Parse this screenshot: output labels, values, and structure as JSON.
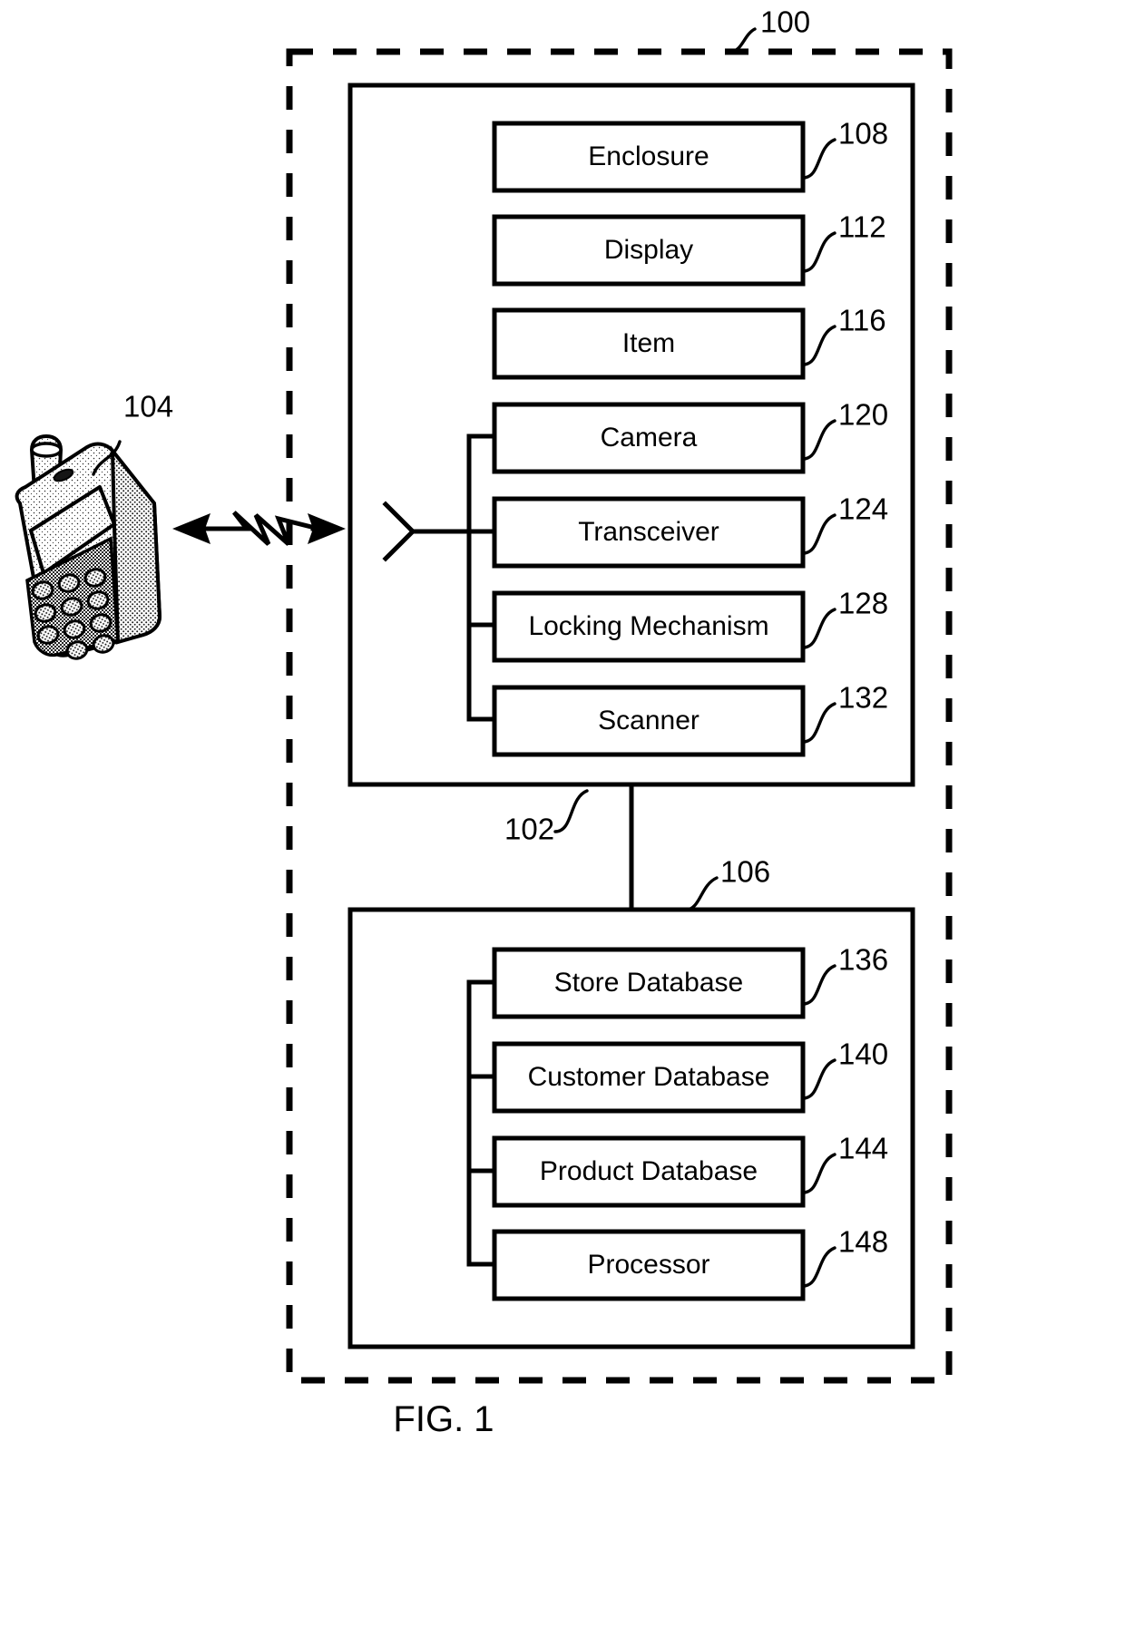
{
  "figure": {
    "caption": "FIG. 1",
    "system_ref": "100",
    "enclosure_unit_ref": "102",
    "server_unit_ref": "106",
    "mobile_device_ref": "104"
  },
  "enclosure_unit": {
    "ref": "102",
    "blocks": [
      {
        "label": "Enclosure",
        "ref": "108",
        "bus_connected": false
      },
      {
        "label": "Display",
        "ref": "112",
        "bus_connected": false
      },
      {
        "label": "Item",
        "ref": "116",
        "bus_connected": false
      },
      {
        "label": "Camera",
        "ref": "120",
        "bus_connected": true
      },
      {
        "label": "Transceiver",
        "ref": "124",
        "bus_connected": true
      },
      {
        "label": "Locking Mechanism",
        "ref": "128",
        "bus_connected": true
      },
      {
        "label": "Scanner",
        "ref": "132",
        "bus_connected": true
      }
    ]
  },
  "server_unit": {
    "ref": "106",
    "blocks": [
      {
        "label": "Store Database",
        "ref": "136"
      },
      {
        "label": "Customer Database",
        "ref": "140"
      },
      {
        "label": "Product Database",
        "ref": "144"
      },
      {
        "label": "Processor",
        "ref": "148"
      }
    ]
  },
  "mobile_device": {
    "ref": "104",
    "icon": "mobile-phone-illustration"
  },
  "link": {
    "icon": "wireless-bidirectional-arrow",
    "antenna_icon": "antenna-symbol"
  },
  "colors": {
    "ink": "#000000",
    "paper": "#ffffff"
  }
}
